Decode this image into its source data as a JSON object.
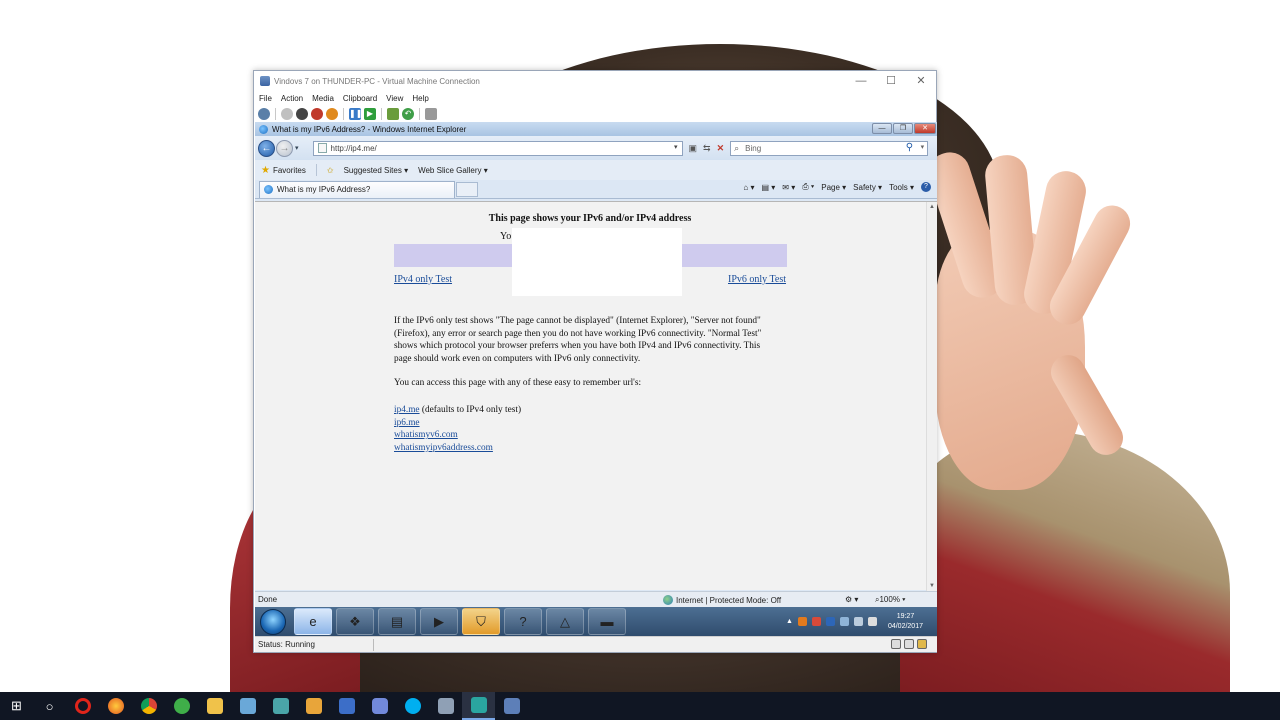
{
  "vm_window": {
    "title": "Vindovs 7 on THUNDER-PC - Virtual Machine Connection",
    "menu": [
      "File",
      "Action",
      "Media",
      "Clipboard",
      "View",
      "Help"
    ],
    "status": "Status: Running"
  },
  "ie": {
    "title": "What is my IPv6 Address? - Windows Internet Explorer",
    "address": "http://ip4.me/",
    "search_placeholder": "Bing",
    "favorites": {
      "favorites_label": "Favorites",
      "suggested_sites": "Suggested Sites ▾",
      "web_slice_gallery": "Web Slice Gallery ▾"
    },
    "tab_label": "What is my IPv6 Address?",
    "command_bar": [
      "Page ▾",
      "Safety ▾",
      "Tools ▾"
    ],
    "status_text": "Done",
    "zone_text": "Internet | Protected Mode: Off",
    "zoom": "100%"
  },
  "page": {
    "heading": "This page shows your IPv6 and/or IPv4 address",
    "your_label": "Yo",
    "ipv4_link": "IPv4 only Test",
    "ipv6_link": "IPv6 only Test",
    "explanation": "If the IPv6 only test shows \"The page cannot be displayed\" (Internet Explorer), \"Server not found\" (Firefox), any error or search page then you do not have working IPv6 connectivity. \"Normal Test\" shows which protocol your browser preferrs when you have both IPv4 and IPv6 connectivity. This page should work even on computers with IPv6 only connectivity.",
    "access_intro": "You can access this page with any of these easy to remember url's:",
    "urls": [
      {
        "link": "ip4.me",
        "note": " (defaults to IPv4 only test)"
      },
      {
        "link": "ip6.me",
        "note": ""
      },
      {
        "link": "whatismyv6.com",
        "note": ""
      },
      {
        "link": "whatismyipv6address.com",
        "note": ""
      }
    ]
  },
  "vm_taskbar": {
    "clock_time": "19:27",
    "clock_date": "04/02/2017"
  },
  "colors": {
    "result_bar": "#cfcbee",
    "link": "#1a4c99"
  }
}
